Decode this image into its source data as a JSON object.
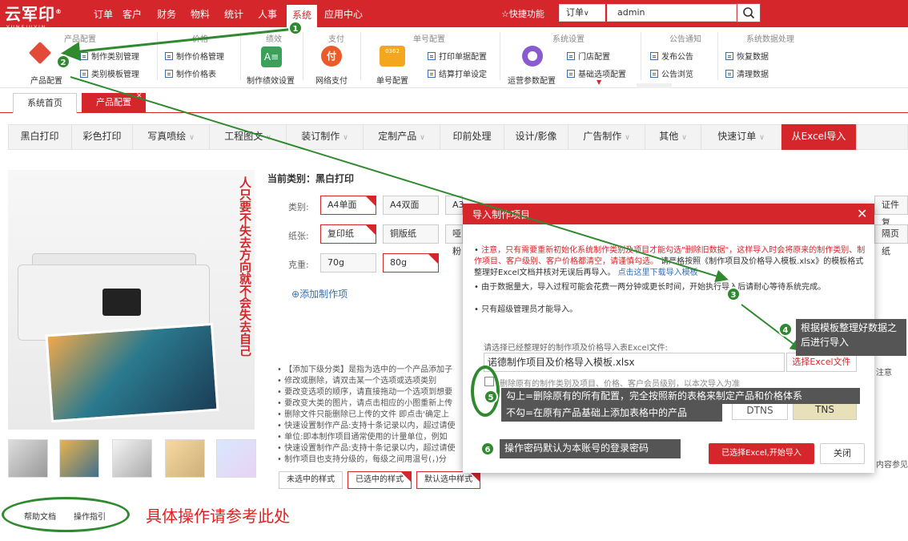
{
  "app": {
    "logo": "云军印",
    "logo_sub": "YUNEJUYIN"
  },
  "nav": [
    "订单",
    "客户",
    "财务",
    "物料",
    "统计",
    "人事",
    "系统",
    "应用中心"
  ],
  "topright": {
    "quick": "快捷功能",
    "order_dd": "订单",
    "search_value": "admin"
  },
  "ribbon": {
    "g1": {
      "title": "产品配置",
      "big": "产品配置",
      "items": [
        "制作类别管理",
        "类别模板管理"
      ]
    },
    "g2": {
      "title": "价格",
      "items": [
        "制作价格管理",
        "制作价格表"
      ]
    },
    "g3": {
      "title": "绩效",
      "big": "制作绩效设置"
    },
    "g4": {
      "title": "支付",
      "big": "网络支付"
    },
    "g5": {
      "title": "单号配置",
      "big": "单号配置",
      "big_badge": "0362",
      "items": [
        "打印单据配置",
        "结算打单设定"
      ]
    },
    "g6": {
      "title": "系统设置",
      "big": "运营参数配置",
      "items": [
        "门店配置",
        "基础选项配置"
      ]
    },
    "g7": {
      "title": "公告通知",
      "items": [
        "发布公告",
        "公告浏览"
      ]
    },
    "g8": {
      "title": "系统数据处理",
      "items": [
        "恢复数据",
        "清理数据"
      ]
    }
  },
  "tabs": {
    "home": "系统首页",
    "config": "产品配置"
  },
  "categories": [
    "黑白打印",
    "彩色打印",
    "写真喷绘",
    "工程图文",
    "装订制作",
    "定制产品",
    "印前处理",
    "设计/影像",
    "广告制作",
    "其他",
    "快速订单",
    "从Excel导入"
  ],
  "product": {
    "vertical_text": "人只要不失去方向就不会失去自己",
    "current_category": "当前类别：黑白打印",
    "type_label": "类别:",
    "types": [
      "A4单面",
      "A4双面",
      "A3"
    ],
    "paper_label": "纸张:",
    "papers": [
      "复印纸",
      "铜版纸",
      "哑粉"
    ],
    "weight_label": "克重:",
    "weights": [
      "70g",
      "80g"
    ],
    "right_type": "证件复",
    "right_paper": "隔页纸",
    "add": "添加制作项",
    "notes": [
      "【添加下级分类】是指为选中的一个产品添加子",
      "修改或删除，请双击某一个选项或选项类别",
      "要改变选项的顺序，请直接拖动一个选项到想要",
      "要改变大类的图片，请点击相应的小图重新上传",
      "删除文件只能删除已上传的文件 即点击'确定上",
      "快速设置制作产品:支持十条记录以内，超过请使",
      "单位:即本制作项目通常使用的计量单位，例如",
      "快速设置制作产品:支持十条记录以内，超过请使",
      "制作项目也支持分级的，每级之间用温号(，)分"
    ],
    "right_fragment": "内容参见",
    "right_fragment2": "注意",
    "legend": [
      "未选中的样式",
      "已选中的样式",
      "默认选中样式"
    ]
  },
  "bottom": {
    "help": "帮助文档",
    "guide": "操作指引",
    "callout": "具体操作请参考此处"
  },
  "dialog": {
    "title": "导入制作项目",
    "note1_red": "注意，只有需要重新初始化系统制作类别及项目才能勾选\"删除旧数据\"，这样导入时会将原来的制作类别、制作项目、客户级别、客户价格都清空，请谨慎勾选。",
    "note1_black": "请严格按照《制作项目及价格导入模板.xlsx》的模板格式整理好Excel文档并核对无误后再导入。",
    "note1_link": "点击这里下载导入模板",
    "note2": "由于数据量大，导入过程可能会花费一两分钟或更长时间，开始执行导入后请耐心等待系统完成。",
    "note3": "只有超级管理员才能导入。",
    "select_label": "请选择已经整理好的制作项及价格导入表Excel文件:",
    "file_value": "诺德制作项目及价格导入模板.xlsx",
    "file_btn": "选择Excel文件",
    "checkbox_text": "删除原有的制作类别及项目、价格、客户会员级别，以本次导入为准",
    "captcha_label": "DTNS",
    "captcha_img": "TNS",
    "start": "已选择Excel,开始导入",
    "close": "关闭"
  },
  "annotations": {
    "b1": "1",
    "b2": "2",
    "b3": "3",
    "b4": "4",
    "b5": "5",
    "b6": "6",
    "c4": "根据模板整理好数据之后进行导入",
    "c5a": "勾上=删除原有的所有配置，完全按照新的表格来制定产品和价格体系",
    "c5b": "不勾=在原有产品基础上添加表格中的产品",
    "c6": "操作密码默认为本账号的登录密码"
  },
  "colors": {
    "brand": "#d5262b",
    "annotation": "#2f8a2f"
  }
}
